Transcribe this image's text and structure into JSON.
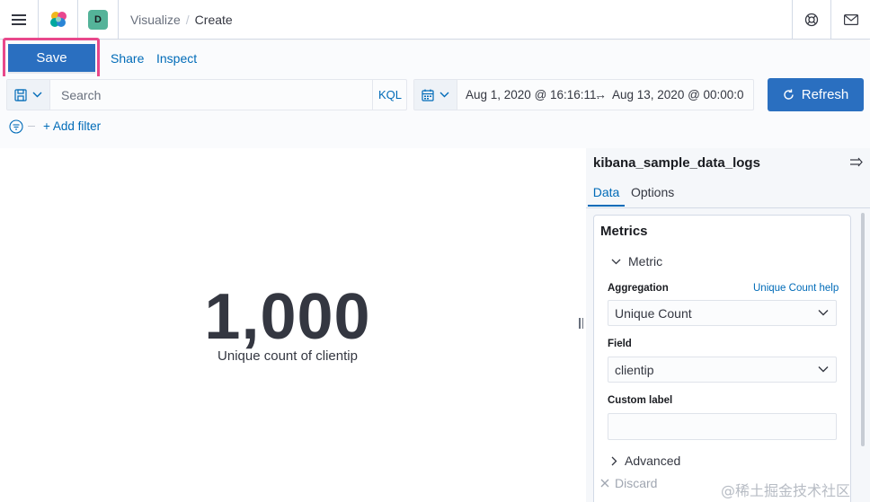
{
  "breadcrumbs": {
    "parent": "Visualize",
    "separator": "/",
    "current": "Create"
  },
  "space": {
    "initial": "D",
    "color": "#54b399"
  },
  "topnav": {
    "save": "Save",
    "share": "Share",
    "inspect": "Inspect"
  },
  "query": {
    "placeholder": "Search",
    "language": "KQL"
  },
  "date": {
    "start": "Aug 1, 2020 @ 16:16:11.",
    "arrow": "→",
    "end": "Aug 13, 2020 @ 00:00:0"
  },
  "refresh": {
    "label": "Refresh"
  },
  "filter": {
    "add_label": "+ Add filter"
  },
  "visualization": {
    "value": "1,000",
    "label": "Unique count of clientip"
  },
  "sidebar": {
    "index": "kibana_sample_data_logs",
    "tabs": {
      "data": "Data",
      "options": "Options"
    },
    "metrics_title": "Metrics",
    "metric_label": "Metric",
    "aggregation_label": "Aggregation",
    "aggregation_help": "Unique Count help",
    "aggregation_value": "Unique Count",
    "field_label": "Field",
    "field_value": "clientip",
    "custom_label": "Custom label",
    "custom_value": "",
    "advanced": "Advanced",
    "discard": "Discard"
  },
  "watermark": "@稀土掘金技术社区",
  "colors": {
    "primary": "#2a6fc0",
    "link": "#006bb8",
    "highlight": "#e8488b",
    "space": "#54b399"
  }
}
